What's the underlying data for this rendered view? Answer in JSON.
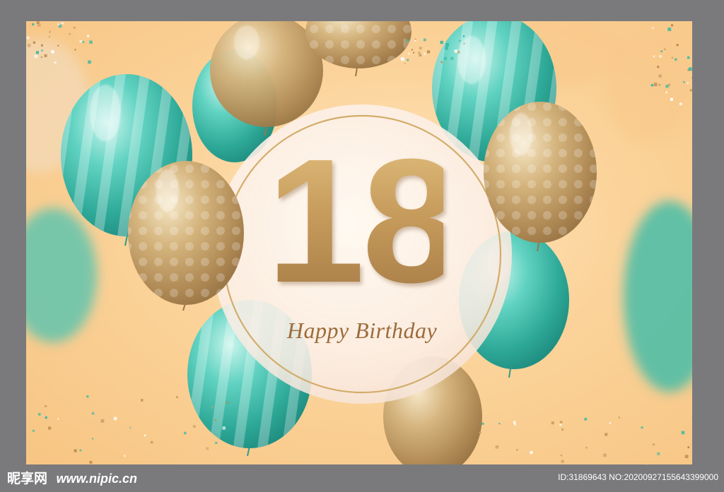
{
  "poster": {
    "age_number": "18",
    "greeting": "Happy  Birthday"
  },
  "watermark": {
    "logo_text": "昵享网",
    "site_url": "www.nipic.cn",
    "image_id": "ID:31869643 NO:20200927155643399000"
  },
  "colors": {
    "frame": "#7a7a7c",
    "background": "#fbd39a",
    "teal_balloon": "#3cbfae",
    "gold_balloon": "#c8a66e",
    "number_gold": "#b88a4e",
    "greeting_text": "#9c6c3c",
    "circle_ring": "#d3ac6a"
  }
}
